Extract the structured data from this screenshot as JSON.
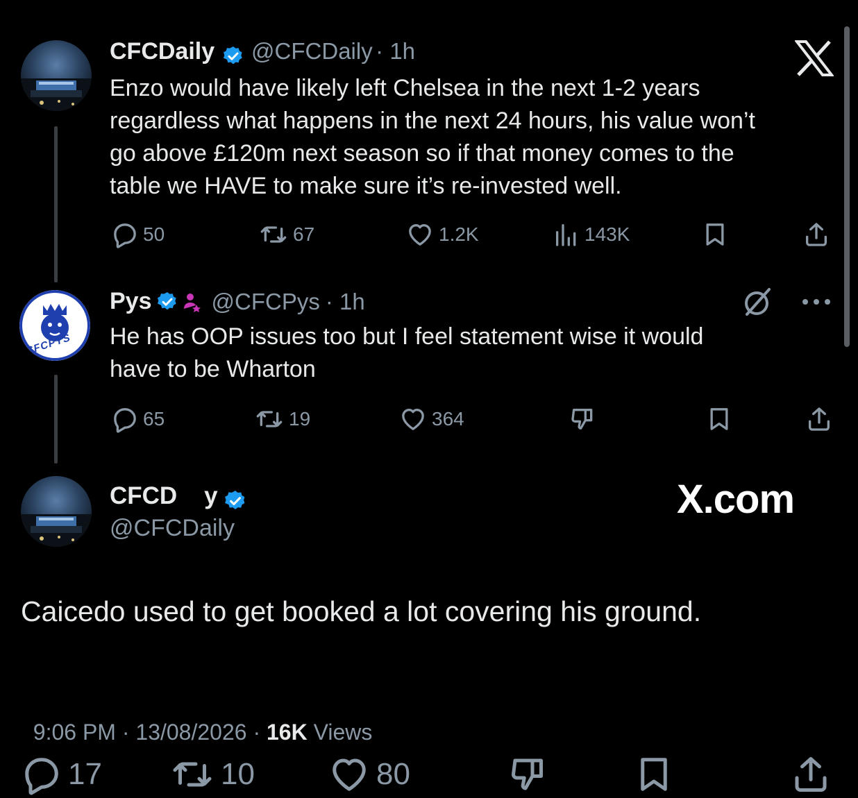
{
  "tweet1": {
    "name": "CFCDaily",
    "handle": "@CFCDaily",
    "time": "· 1h",
    "text_lines": [
      "Enzo would have likely left Chelsea in the next 1-2 years",
      "regardless what happens in the next 24 hours, his value won’t",
      "go above £120m next season so if that money comes to the",
      "table we HAVE to make sure it’s re-invested well."
    ],
    "replies": "50",
    "reposts": "67",
    "likes": "1.2K",
    "views": "143K"
  },
  "tweet2": {
    "name": "Pys",
    "handle": "@CFCPys",
    "time": "· 1h",
    "avatar_text": "CFCPYS",
    "text_lines": [
      "He has OOP issues too but I feel statement wise it would",
      "have to be Wharton"
    ],
    "replies": "65",
    "reposts": "19",
    "likes": "364"
  },
  "main": {
    "name": "CFCD    y",
    "handle": "@CFCDaily",
    "watermark": "X.com",
    "text": "Caicedo used to get booked a lot covering his ground.",
    "time": "9:06 PM · 13/08/2026 · ",
    "views_count": "16K",
    "views_label": " Views",
    "replies": "17",
    "reposts": "10",
    "likes": "80"
  },
  "icons": {
    "x_logo": "x-logo-icon",
    "verified": "verified-badge-icon",
    "reply": "reply-icon",
    "repost": "repost-icon",
    "like": "heart-icon",
    "views": "views-icon",
    "bookmark": "bookmark-icon",
    "share": "share-icon",
    "grok": "grok-icon",
    "more": "more-icon",
    "dislike": "dislike-icon",
    "affiliate": "affiliate-icon"
  },
  "colors": {
    "background": "#000000",
    "text": "#e7e9ea",
    "secondary": "#8b98a5",
    "verified": "#1d9bf0",
    "affiliate": "#c936b8"
  }
}
